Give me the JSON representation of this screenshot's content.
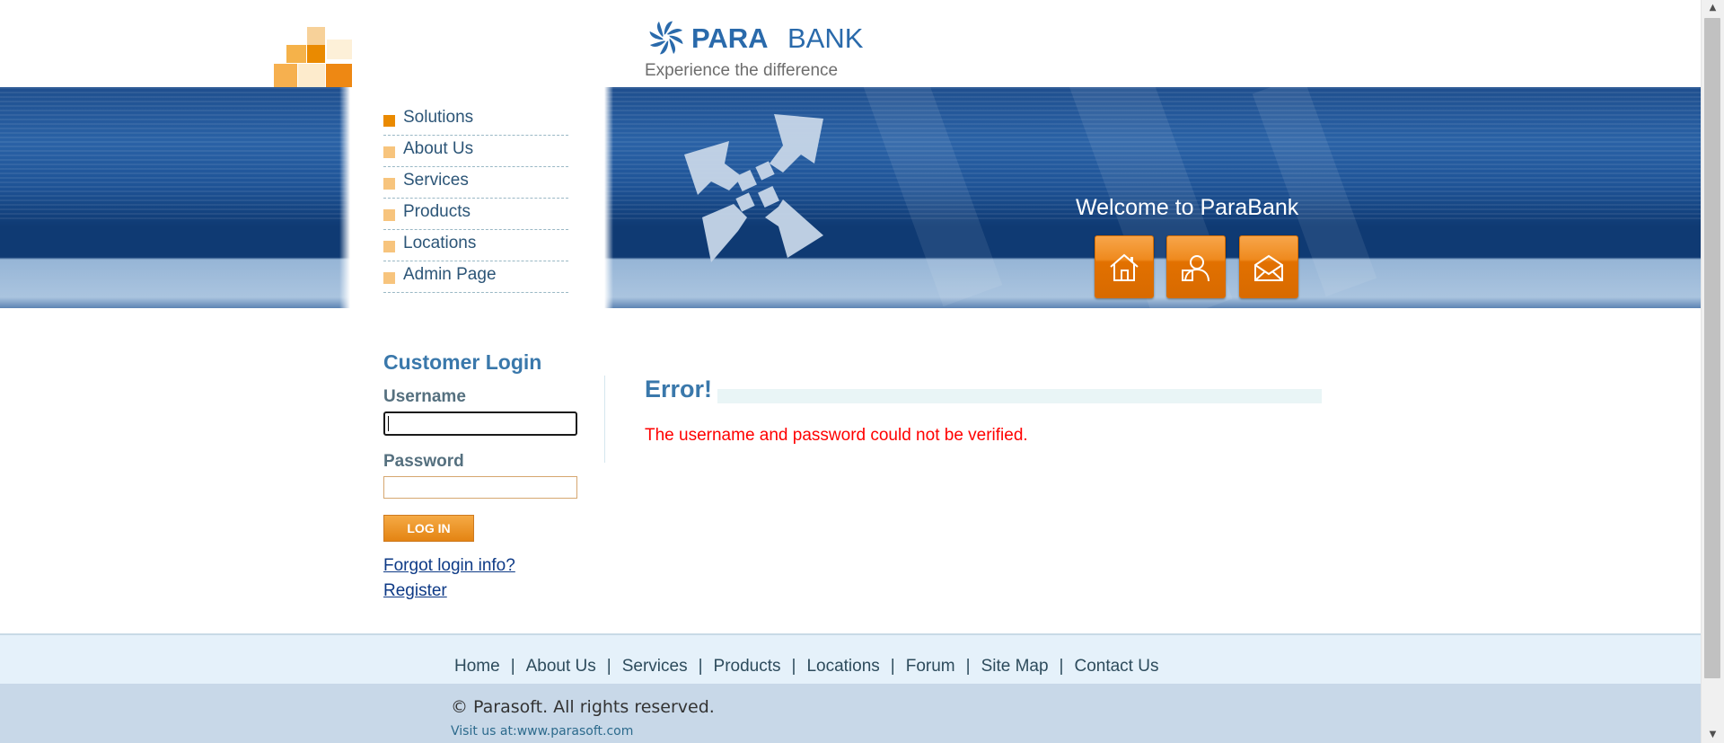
{
  "brand": {
    "name_bold": "PARA",
    "name_light": "BANK",
    "tagline": "Experience the difference",
    "accent": "#ea8a00",
    "primary": "#2a6aab"
  },
  "leftnav": {
    "items": [
      {
        "label": "Solutions",
        "active": true
      },
      {
        "label": "About Us"
      },
      {
        "label": "Services"
      },
      {
        "label": "Products"
      },
      {
        "label": "Locations"
      },
      {
        "label": "Admin Page"
      }
    ]
  },
  "header": {
    "welcome": "Welcome to ParaBank",
    "quick_links": [
      {
        "icon": "home-icon"
      },
      {
        "icon": "about-icon"
      },
      {
        "icon": "contact-icon"
      }
    ]
  },
  "login": {
    "title": "Customer Login",
    "username_label": "Username",
    "username_value": "",
    "password_label": "Password",
    "password_value": "",
    "button": "LOG IN",
    "forgot": "Forgot login info?",
    "register": "Register"
  },
  "main": {
    "error_title": "Error!",
    "error_message": "The username and password could not be verified."
  },
  "footer": {
    "links": [
      "Home",
      "About Us",
      "Services",
      "Products",
      "Locations",
      "Forum",
      "Site Map",
      "Contact Us"
    ],
    "separator": "|",
    "copyright": "© Parasoft. All rights reserved.",
    "visit_prefix": "Visit us at:",
    "visit_link": "www.parasoft.com"
  }
}
